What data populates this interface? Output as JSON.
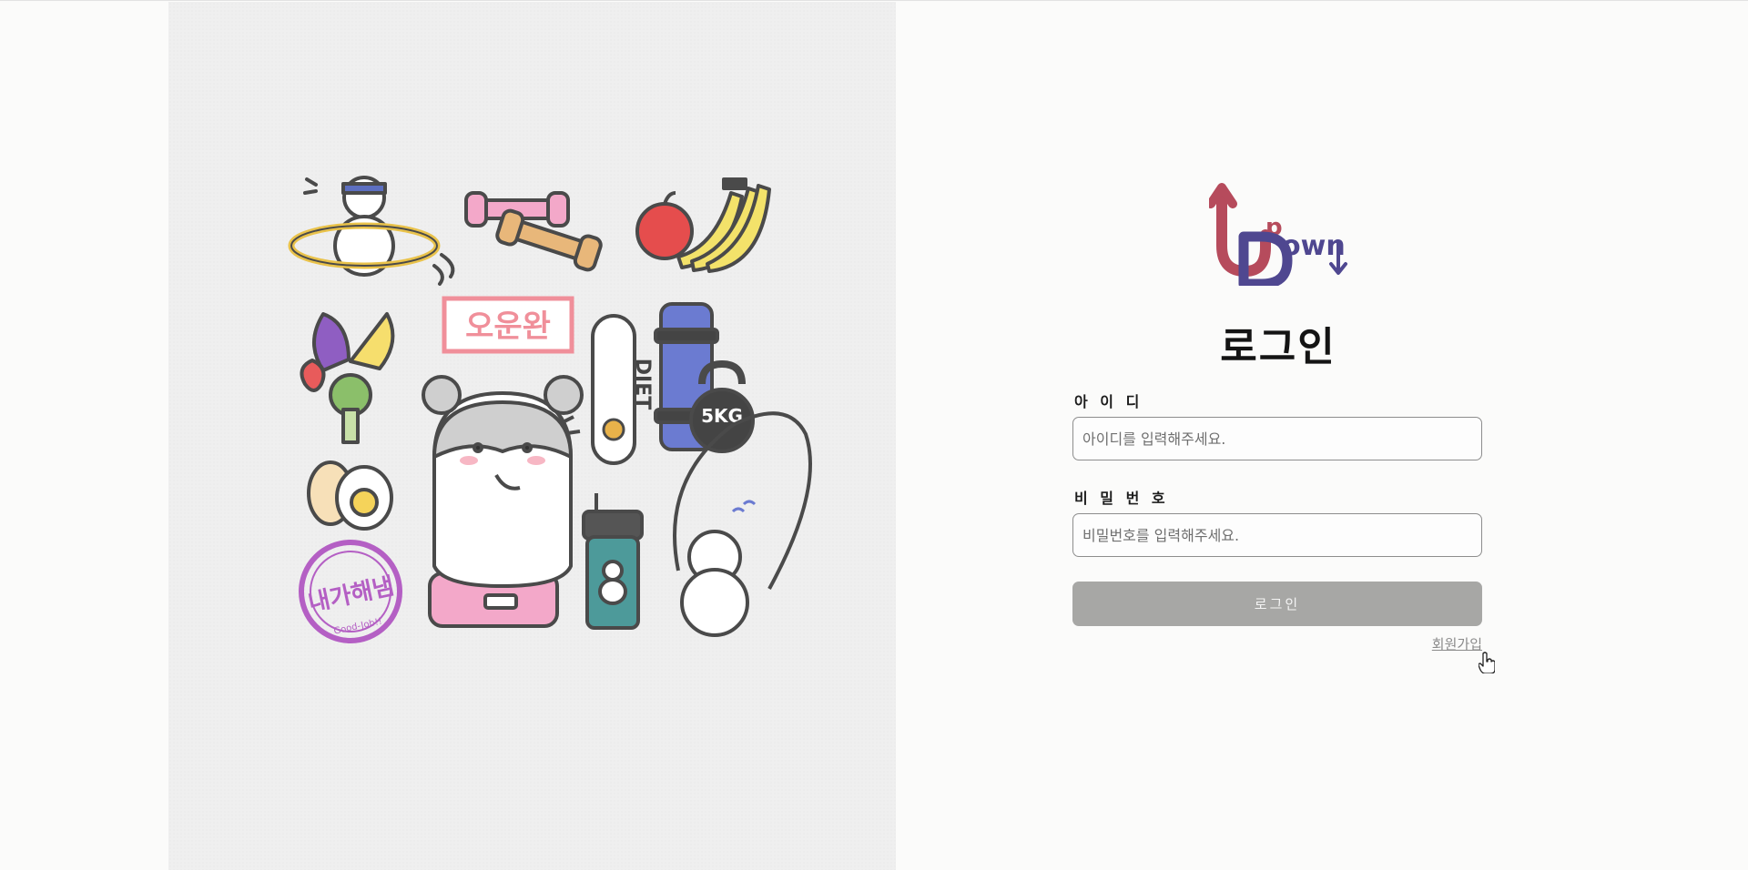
{
  "brand": {
    "logo_alt": "UpDown",
    "colors": {
      "up_red": "#b64b5c",
      "down_purple": "#4f4790"
    }
  },
  "illustration": {
    "sign_text": "오운완",
    "bottle_text": "DIET",
    "kettlebell_text": "5KG",
    "stamp_text": "내가해냄",
    "stamp_subtext": "Good-Job!!"
  },
  "login": {
    "title": "로그인",
    "id_label": "아 이 디",
    "id_placeholder": "아이디를 입력해주세요.",
    "pw_label": "비 밀 번 호",
    "pw_placeholder": "비밀번호를 입력해주세요.",
    "submit_label": "로그인",
    "signup_label": "회원가입"
  },
  "colors": {
    "button_bg": "#a7a7a5",
    "input_border": "#8d8d8d",
    "panel_bg": "#efefef"
  }
}
